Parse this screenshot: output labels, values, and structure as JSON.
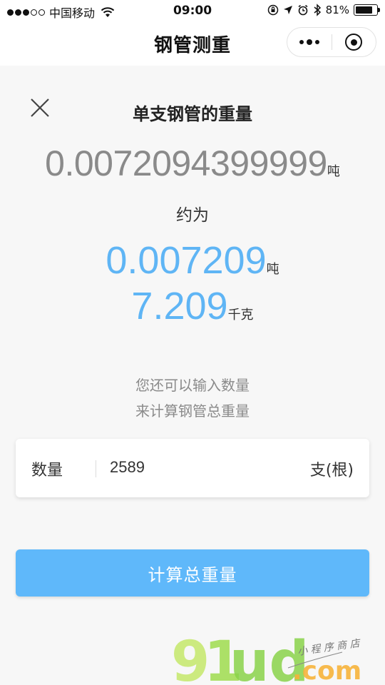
{
  "status_bar": {
    "carrier": "中国移动",
    "time": "09:00",
    "battery": "81%",
    "battery_level": 0.81,
    "icons": [
      "signal-dots",
      "wifi-icon",
      "rotation-lock-icon",
      "location-icon",
      "alarm-icon",
      "bluetooth-icon",
      "battery-icon"
    ]
  },
  "nav": {
    "title": "钢管测重",
    "icons": [
      "more-icon",
      "close-target-icon"
    ]
  },
  "result": {
    "title": "单支钢管的重量",
    "raw_value": "0.0072094399999",
    "raw_unit": "吨",
    "approx_label": "约为",
    "ton_value": "0.007209",
    "ton_unit": "吨",
    "kg_value": "7.209",
    "kg_unit": "千克"
  },
  "hint": {
    "line1": "您还可以输入数量",
    "line2": "来计算钢管总重量"
  },
  "quantity": {
    "label": "数量",
    "value": "2589",
    "unit": "支(根)"
  },
  "calc_button": {
    "label": "计算总重量"
  },
  "watermark": {
    "brand": "91ud",
    "domain": ".com",
    "tagline": "小程序商店"
  },
  "colors": {
    "accent": "#5fb5f5",
    "button": "#5fb8fa",
    "background": "#f7f7f7",
    "muted": "#8a8a8a"
  }
}
